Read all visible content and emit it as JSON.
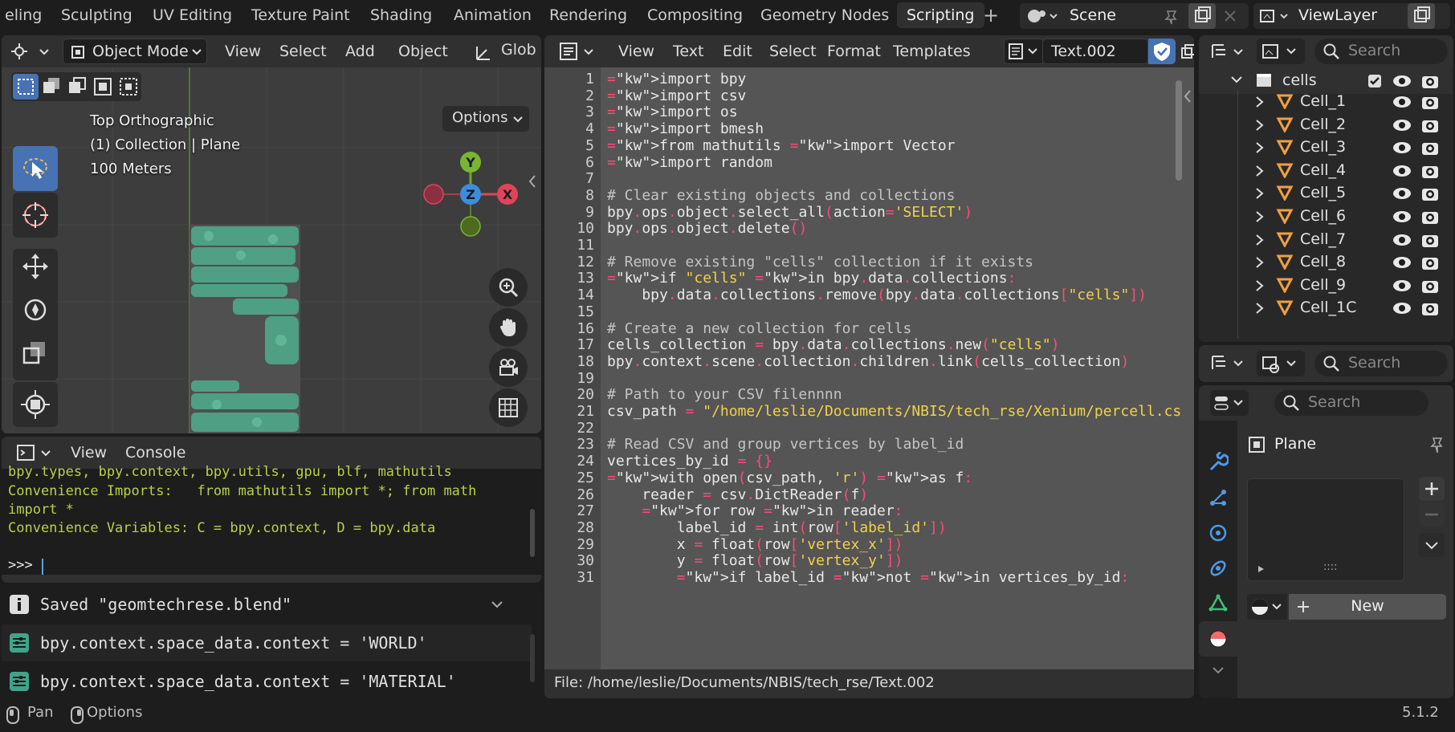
{
  "workspace_tabs": [
    "eling",
    "Sculpting",
    "UV Editing",
    "Texture Paint",
    "Shading",
    "Animation",
    "Rendering",
    "Compositing",
    "Geometry Nodes",
    "Scripting"
  ],
  "scene_name": "Scene",
  "view_layer_name": "ViewLayer",
  "viewport": {
    "mode": "Object Mode",
    "menus": [
      "View",
      "Select",
      "Add",
      "Object"
    ],
    "transform_orientation": "Glob",
    "options_label": "Options",
    "overlay_lines": [
      "Top Orthographic",
      "(1) Collection | Plane",
      "100 Meters"
    ],
    "gizmo_axes": {
      "y": "Y",
      "z": "Z",
      "x": "X"
    }
  },
  "console": {
    "menus": [
      "View",
      "Console"
    ],
    "lines": [
      "bpy.types, bpy.context, bpy.utils, gpu, blf, mathutils",
      "Convenience Imports:   from mathutils import *; from math",
      "import *",
      "Convenience Variables: C = bpy.context, D = bpy.data",
      "",
      ">>> "
    ]
  },
  "info_log": [
    {
      "icon": "info-icon",
      "text": "Saved \"geomtechrese.blend\""
    },
    {
      "icon": "operator-icon",
      "text": "bpy.context.space_data.context = 'WORLD'"
    },
    {
      "icon": "operator-icon",
      "text": "bpy.context.space_data.context = 'MATERIAL'"
    }
  ],
  "text_editor": {
    "menus": [
      "View",
      "Text",
      "Edit",
      "Select",
      "Format",
      "Templates"
    ],
    "text_name": "Text.002",
    "footer": "File: /home/leslie/Documents/NBIS/tech_rse/Text.002",
    "lines": [
      "import bpy",
      "import csv",
      "import os",
      "import bmesh",
      "from mathutils import Vector",
      "import random",
      "",
      "# Clear existing objects and collections",
      "bpy.ops.object.select_all(action='SELECT')",
      "bpy.ops.object.delete()",
      "",
      "# Remove existing \"cells\" collection if it exists",
      "if \"cells\" in bpy.data.collections:",
      "    bpy.data.collections.remove(bpy.data.collections[\"cells\"])",
      "",
      "# Create a new collection for cells",
      "cells_collection = bpy.data.collections.new(\"cells\")",
      "bpy.context.scene.collection.children.link(cells_collection)",
      "",
      "# Path to your CSV filennnn",
      "csv_path = \"/home/leslie/Documents/NBIS/tech_rse/Xenium/percell.cs",
      "",
      "# Read CSV and group vertices by label_id",
      "vertices_by_id = {}",
      "with open(csv_path, 'r') as f:",
      "    reader = csv.DictReader(f)",
      "    for row in reader:",
      "        label_id = int(row['label_id'])",
      "        x = float(row['vertex_x'])",
      "        y = float(row['vertex_y'])",
      "        if label_id not in vertices_by_id:"
    ]
  },
  "outliner": {
    "search_placeholder": "Search",
    "collection": "cells",
    "items": [
      "Cell_1",
      "Cell_2",
      "Cell_3",
      "Cell_4",
      "Cell_5",
      "Cell_6",
      "Cell_7",
      "Cell_8",
      "Cell_9",
      "Cell_1C"
    ]
  },
  "properties": {
    "search_placeholder": "Search",
    "search_placeholder_2": "Search",
    "object_name": "Plane",
    "new_label": "New",
    "list_handle": "::::"
  },
  "status_bar": {
    "pan_label": "Pan",
    "options_label": "Options",
    "version": "5.1.2"
  },
  "colors": {
    "accent": "#4772b3",
    "keyword": "#ff4a77",
    "string": "#f2d14a",
    "console_text": "#b8d14a",
    "cell_green": "#5fb89a"
  }
}
